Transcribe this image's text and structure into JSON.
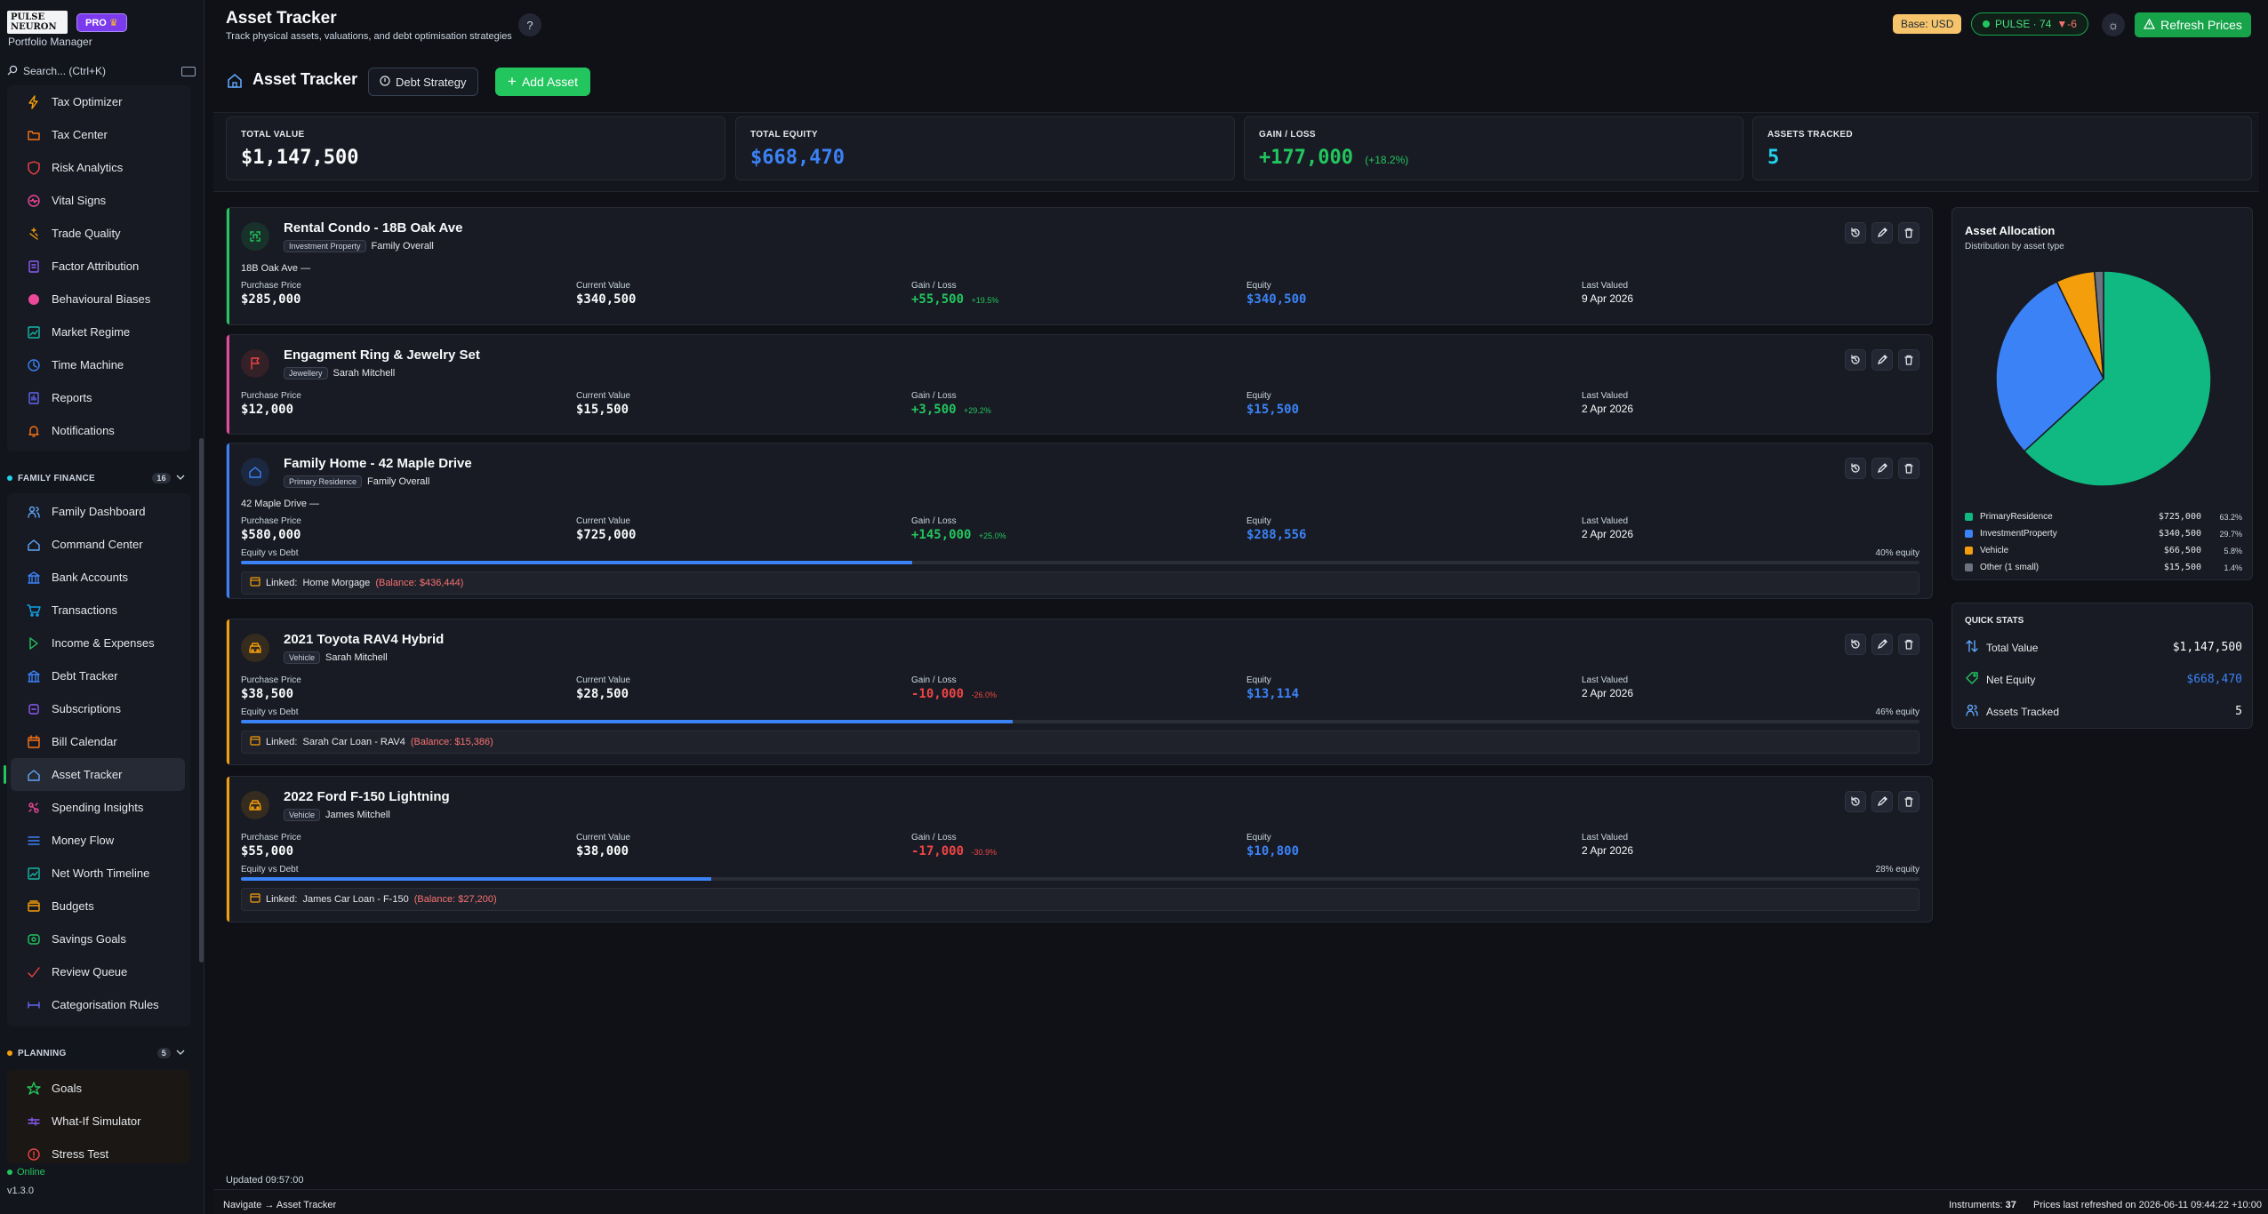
{
  "app": {
    "logo_text": "PULSE NEURON",
    "badge": "PRO",
    "subtitle": "Portfolio Manager"
  },
  "search": {
    "placeholder": "Search... (Ctrl+K)"
  },
  "sidebar": {
    "analytics_items": [
      {
        "label": "Tax Optimizer",
        "icon": "bolt-icon"
      },
      {
        "label": "Tax Center",
        "icon": "folder-icon"
      },
      {
        "label": "Risk Analytics",
        "icon": "shield-icon"
      },
      {
        "label": "Vital Signs",
        "icon": "pulse-icon"
      },
      {
        "label": "Trade Quality",
        "icon": "sparkle-icon"
      },
      {
        "label": "Factor Attribution",
        "icon": "document-icon"
      },
      {
        "label": "Behavioural Biases",
        "icon": "circle-icon"
      },
      {
        "label": "Market Regime",
        "icon": "chart-icon"
      },
      {
        "label": "Time Machine",
        "icon": "clock-icon"
      },
      {
        "label": "Reports",
        "icon": "report-icon"
      },
      {
        "label": "Notifications",
        "icon": "bell-icon"
      }
    ],
    "family_section": {
      "title": "FAMILY FINANCE",
      "count": "16"
    },
    "family_items": [
      {
        "label": "Family Dashboard",
        "icon": "users-icon"
      },
      {
        "label": "Command Center",
        "icon": "home-icon"
      },
      {
        "label": "Bank Accounts",
        "icon": "bank-icon"
      },
      {
        "label": "Transactions",
        "icon": "cart-icon"
      },
      {
        "label": "Income & Expenses",
        "icon": "arrow-icon"
      },
      {
        "label": "Debt Tracker",
        "icon": "bank-icon"
      },
      {
        "label": "Subscriptions",
        "icon": "repeat-icon"
      },
      {
        "label": "Bill Calendar",
        "icon": "calendar-icon"
      },
      {
        "label": "Asset Tracker",
        "icon": "home-icon",
        "active": true
      },
      {
        "label": "Spending Insights",
        "icon": "pie-icon"
      },
      {
        "label": "Money Flow",
        "icon": "flow-icon"
      },
      {
        "label": "Net Worth Timeline",
        "icon": "chart-icon"
      },
      {
        "label": "Budgets",
        "icon": "wallet-icon"
      },
      {
        "label": "Savings Goals",
        "icon": "piggy-icon"
      },
      {
        "label": "Review Queue",
        "icon": "check-icon"
      },
      {
        "label": "Categorisation Rules",
        "icon": "rules-icon"
      }
    ],
    "planning_section": {
      "title": "PLANNING",
      "count": "5"
    },
    "planning_items": [
      {
        "label": "Goals",
        "icon": "star-icon"
      },
      {
        "label": "What-If Simulator",
        "icon": "sliders-icon"
      },
      {
        "label": "Stress Test",
        "icon": "alert-icon"
      }
    ],
    "status": "Online",
    "version": "v1.3.0"
  },
  "header": {
    "title": "Asset Tracker",
    "description": "Track physical assets, valuations, and debt optimisation strategies",
    "help": "?",
    "base_currency": "Base: USD",
    "pulse_label": "PULSE · 74",
    "pulse_delta": "▼-6",
    "refresh_label": "Refresh Prices"
  },
  "toolbar": {
    "title": "Asset Tracker",
    "debt_strategy": "Debt Strategy",
    "add_asset": "Add Asset"
  },
  "stats": [
    {
      "label": "TOTAL VALUE",
      "value": "$1,147,500",
      "pct": "",
      "color": "#f9fafb"
    },
    {
      "label": "TOTAL EQUITY",
      "value": "$668,470",
      "pct": "",
      "color": "#3b82f6"
    },
    {
      "label": "GAIN / LOSS",
      "value": "+177,000",
      "pct": "(+18.2%)",
      "color": "#22c55e"
    },
    {
      "label": "ASSETS TRACKED",
      "value": "5",
      "pct": "",
      "color": "#22d3ee"
    }
  ],
  "labels": {
    "purchase": "Purchase Price",
    "current": "Current Value",
    "gain": "Gain / Loss",
    "equity": "Equity",
    "last_valued": "Last Valued",
    "equity_vs_debt": "Equity vs Debt",
    "linked_prefix": "Linked:"
  },
  "assets": [
    {
      "name": "Rental Condo - 18B Oak Ave",
      "tag": "Investment Property",
      "owner": "Family Overall",
      "address": "18B Oak Ave  —",
      "purchase": "$285,000",
      "current": "$340,500",
      "gain": "+55,500",
      "gain_pct": "+19.5%",
      "equity": "$340,500",
      "last_valued": "9 Apr 2026",
      "accent": "#22c55e",
      "icon_color": "#22c55e"
    },
    {
      "name": "Engagment Ring & Jewelry Set",
      "tag": "Jewellery",
      "owner": "Sarah Mitchell",
      "address": "",
      "purchase": "$12,000",
      "current": "$15,500",
      "gain": "+3,500",
      "gain_pct": "+29.2%",
      "equity": "$15,500",
      "last_valued": "2 Apr 2026",
      "accent": "#ec4899",
      "icon_color": "#ef4444"
    },
    {
      "name": "Family Home - 42 Maple Drive",
      "tag": "Primary Residence",
      "owner": "Family Overall",
      "address": "42 Maple Drive  —",
      "purchase": "$580,000",
      "current": "$725,000",
      "gain": "+145,000",
      "gain_pct": "+25.0%",
      "equity": "$288,556",
      "last_valued": "2 Apr 2026",
      "equity_pct": "40% equity",
      "equity_frac": 0.4,
      "loan": "Home Morgage",
      "balance": "(Balance: $436,444)",
      "accent": "#3b82f6",
      "icon_color": "#3b82f6"
    },
    {
      "name": "2021 Toyota RAV4 Hybrid",
      "tag": "Vehicle",
      "owner": "Sarah Mitchell",
      "address": "",
      "purchase": "$38,500",
      "current": "$28,500",
      "gain": "-10,000",
      "gain_pct": "-26.0%",
      "equity": "$13,114",
      "last_valued": "2 Apr 2026",
      "equity_pct": "46% equity",
      "equity_frac": 0.46,
      "loan": "Sarah Car Loan - RAV4",
      "balance": "(Balance: $15,386)",
      "accent": "#f59e0b",
      "icon_color": "#f59e0b"
    },
    {
      "name": "2022 Ford F-150 Lightning",
      "tag": "Vehicle",
      "owner": "James Mitchell",
      "address": "",
      "purchase": "$55,000",
      "current": "$38,000",
      "gain": "-17,000",
      "gain_pct": "-30.9%",
      "equity": "$10,800",
      "last_valued": "2 Apr 2026",
      "equity_pct": "28% equity",
      "equity_frac": 0.28,
      "loan": "James Car Loan - F-150",
      "balance": "(Balance: $27,200)",
      "accent": "#f59e0b",
      "icon_color": "#f59e0b"
    }
  ],
  "allocation": {
    "title": "Asset Allocation",
    "subtitle": "Distribution by asset type"
  },
  "chart_data": {
    "type": "pie",
    "categories": [
      "PrimaryResidence",
      "InvestmentProperty",
      "Vehicle",
      "Other (1 small)"
    ],
    "values": [
      725000,
      340500,
      66500,
      15500
    ],
    "value_labels": [
      "$725,000",
      "$340,500",
      "$66,500",
      "$15,500"
    ],
    "percent_labels": [
      "63.2%",
      "29.7%",
      "5.8%",
      "1.4%"
    ],
    "colors": [
      "#10b981",
      "#3b82f6",
      "#f59e0b",
      "#6b7280"
    ]
  },
  "quick_stats": {
    "title": "QUICK STATS",
    "rows": [
      {
        "label": "Total Value",
        "value": "$1,147,500",
        "color": "#f9fafb",
        "icon": "arrows-icon"
      },
      {
        "label": "Net Equity",
        "value": "$668,470",
        "color": "#3b82f6",
        "icon": "tag-icon"
      },
      {
        "label": "Assets Tracked",
        "value": "5",
        "color": "#f9fafb",
        "icon": "users-icon"
      }
    ]
  },
  "footer": {
    "updated": "Updated 09:57:00",
    "navigate": "Navigate → Asset Tracker",
    "instruments_label": "Instruments:",
    "instruments_count": "37",
    "refreshed": "Prices last refreshed on 2026-06-11 09:44:22 +10:00"
  }
}
